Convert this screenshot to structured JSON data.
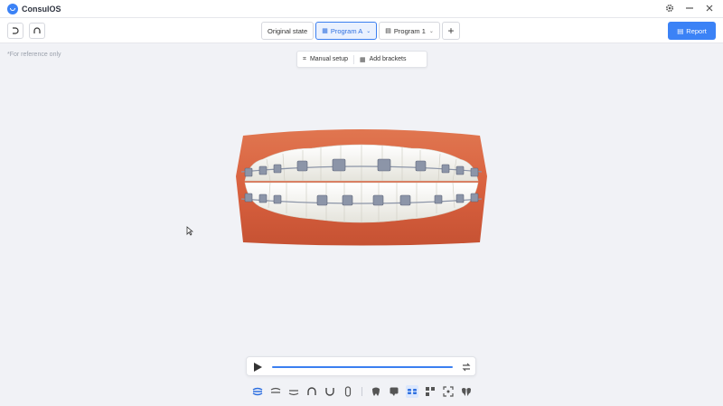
{
  "app": {
    "title": "ConsulOS"
  },
  "window_controls": {
    "settings_icon": "gear-icon",
    "minimize_icon": "minimize-icon",
    "close_icon": "close-icon"
  },
  "toolbar": {
    "left_icons": [
      "undo-arch-icon",
      "arch-icon"
    ],
    "tabs": [
      {
        "label": "Original state",
        "active": false
      },
      {
        "label": "Program A",
        "active": true
      },
      {
        "label": "Program 1",
        "active": false
      }
    ],
    "add_tab_icon": "plus-icon",
    "report_label": "Report"
  },
  "reference_note": "*For reference only",
  "setup": {
    "manual_setup_label": "Manual setup",
    "add_brackets_label": "Add brackets"
  },
  "player": {
    "progress": 1.0
  },
  "view_tools": [
    "jaws-icon",
    "upper-jaw-icon",
    "lower-jaw-icon",
    "upper-arch-icon",
    "lower-arch-icon",
    "rotate-icon",
    "tooth-icon",
    "bubble-icon",
    "brackets-icon",
    "grid-icon",
    "frame-icon",
    "teeth-icon"
  ],
  "colors": {
    "accent": "#3b82f6",
    "gum": "#d9613f",
    "tooth": "#f4f3ee",
    "bracket": "#8c95a8"
  }
}
